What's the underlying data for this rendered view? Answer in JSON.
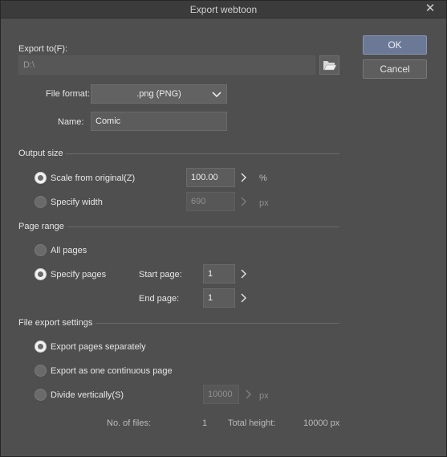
{
  "window": {
    "title": "Export webtoon",
    "close_glyph": "✕"
  },
  "buttons": {
    "ok": "OK",
    "cancel": "Cancel"
  },
  "export_to": {
    "label": "Export to(F):",
    "path": "D:\\",
    "browse_icon": "folder-open-icon"
  },
  "file_format": {
    "label": "File format:",
    "value": ".png (PNG)"
  },
  "name": {
    "label": "Name:",
    "value": "Comic"
  },
  "output_size": {
    "title": "Output size",
    "scale": {
      "label": "Scale from original(Z)",
      "value": "100.00",
      "unit": "%",
      "selected": true
    },
    "width": {
      "label": "Specify width",
      "value": "690",
      "unit": "px",
      "selected": false
    }
  },
  "page_range": {
    "title": "Page range",
    "all_pages": {
      "label": "All pages",
      "selected": false
    },
    "specify_pages": {
      "label": "Specify pages",
      "selected": true
    },
    "start_page": {
      "label": "Start page:",
      "value": "1"
    },
    "end_page": {
      "label": "End page:",
      "value": "1"
    }
  },
  "file_export_settings": {
    "title": "File export settings",
    "separately": {
      "label": "Export pages separately",
      "selected": true
    },
    "continuous": {
      "label": "Export as one continuous page",
      "selected": false
    },
    "divide": {
      "label": "Divide vertically(S)",
      "value": "10000",
      "unit": "px",
      "selected": false
    }
  },
  "summary": {
    "files_label": "No. of files:",
    "files_value": "1",
    "height_label": "Total height:",
    "height_value": "10000 px"
  },
  "colors": {
    "background": "#4f4f4f",
    "accent_ok": "#6b7896"
  }
}
